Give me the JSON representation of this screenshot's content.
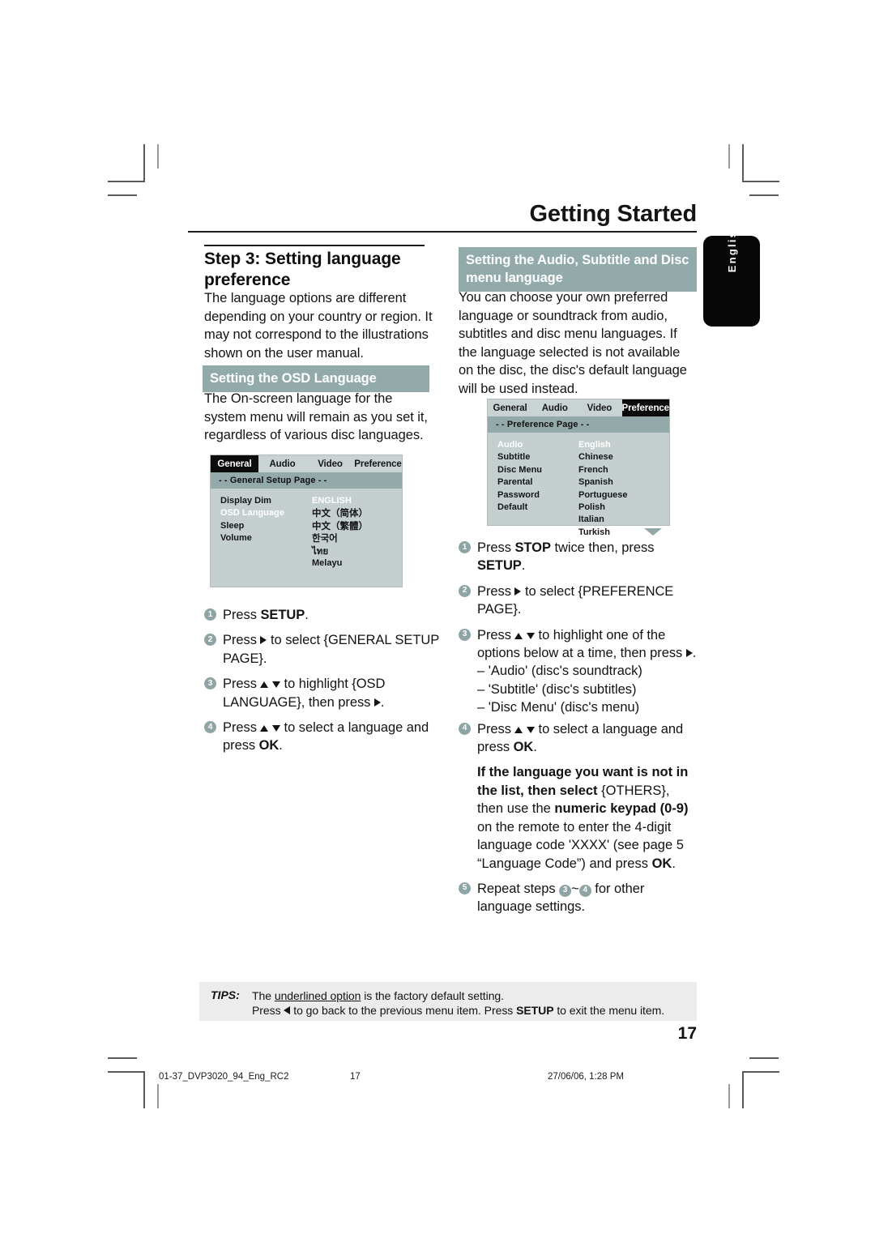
{
  "header": {
    "chapter_title": "Getting Started",
    "side_tab_label": "English"
  },
  "left_column": {
    "step_title": "Step 3:  Setting language preference",
    "intro_text": "The language options are different depending on your country or region. It may not correspond to the illustrations shown on the user manual.",
    "osd_heading": "Setting the OSD Language",
    "osd_text": "The On-screen language for the system menu will remain as you set it, regardless of various disc languages.",
    "osd_screen": {
      "tabs": [
        "General",
        "Audio",
        "Video",
        "Preference"
      ],
      "active_tab": "General",
      "page_bar": "- -  General Setup Page   - -",
      "menu_items": [
        "Display Dim",
        "OSD Language",
        "Sleep",
        "Volume"
      ],
      "highlighted_menu_item": "OSD Language",
      "values": [
        "ENGLISH",
        "中文（简体）",
        "中文（繁體）",
        "한국어",
        "ไทย",
        "Melayu"
      ],
      "highlighted_value": "ENGLISH"
    },
    "steps": [
      {
        "num": "1",
        "text_parts": [
          "Press ",
          "SETUP",
          "."
        ]
      },
      {
        "num": "2",
        "text_parts": [
          "Press ",
          "▶",
          " to select {GENERAL SETUP PAGE}."
        ]
      },
      {
        "num": "3",
        "text_parts": [
          "Press ",
          "▲ ▼",
          " to highlight {OSD LANGUAGE}, then press ",
          "▶",
          "."
        ]
      },
      {
        "num": "4",
        "text_parts": [
          "Press ",
          "▲ ▼",
          " to select a language and press ",
          "OK",
          "."
        ]
      }
    ]
  },
  "right_column": {
    "audio_heading": "Setting the Audio, Subtitle and Disc menu language",
    "pref_intro": "You can choose your own preferred language or soundtrack from audio, subtitles and disc menu languages. If the language selected is not available on the disc, the disc's default language will be used instead.",
    "pref_screen": {
      "tabs": [
        "General",
        "Audio",
        "Video",
        "Preference"
      ],
      "active_tab": "Preference",
      "page_bar": "- -  Preference Page   - -",
      "menu_items": [
        "Audio",
        "Subtitle",
        "Disc Menu",
        "Parental",
        "Password",
        "Default"
      ],
      "highlighted_menu_item": "Audio",
      "values": [
        "English",
        "Chinese",
        "French",
        "Spanish",
        "Portuguese",
        "Polish",
        "Italian",
        "Turkish"
      ],
      "highlighted_value": "English",
      "scroll_indicator": "scroll-down-arrow"
    },
    "steps": [
      {
        "num": "1",
        "text": "Press STOP twice then, press SETUP."
      },
      {
        "num": "2",
        "text": "Press ▶ to select {PREFERENCE PAGE}."
      },
      {
        "num": "3",
        "text": "Press ▲ ▼ to highlight one of the options below at a time, then press ▶."
      },
      {
        "num": "4",
        "text": "Press ▲ ▼ to select a language and press OK."
      },
      {
        "num": "5",
        "text": "Repeat steps 3~4 for other language settings."
      }
    ],
    "step3_options": [
      "–  'Audio' (disc's soundtrack)",
      "–  'Subtitle' (disc's subtitles)",
      "–  'Disc Menu' (disc's menu)"
    ],
    "others_note": {
      "bold_lead": "If the language you want is not in the list, then select",
      "braced": "{OTHERS},",
      "rest_1": "then use the ",
      "bold_keypad": "numeric keypad (0-9)",
      "rest_2": " on the remote to enter the 4-digit language code 'XXXX' (see page 5 “Language Code”) and press ",
      "bold_ok": "OK",
      "rest_3": "."
    }
  },
  "tips": {
    "label": "TIPS:",
    "line1_pre": "The ",
    "line1_underlined": "underlined option",
    "line1_post": " is the factory default setting.",
    "line2_a": "Press ",
    "line2_b": " to go back to the previous menu item. Press ",
    "line2_setup": "SETUP",
    "line2_c": " to exit the menu item."
  },
  "page_number": "17",
  "print_footer": {
    "file": "01-37_DVP3020_94_Eng_RC2",
    "page": "17",
    "date": "27/06/06, 1:28 PM"
  },
  "colors": {
    "teal_band": "#92aaaa",
    "osd_background": "#c5cfcf",
    "osd_page_bar": "#94aaaa",
    "bullet": "#8fa5a5",
    "tips_background": "#ececec",
    "tab_active": "#0c0c0c"
  }
}
